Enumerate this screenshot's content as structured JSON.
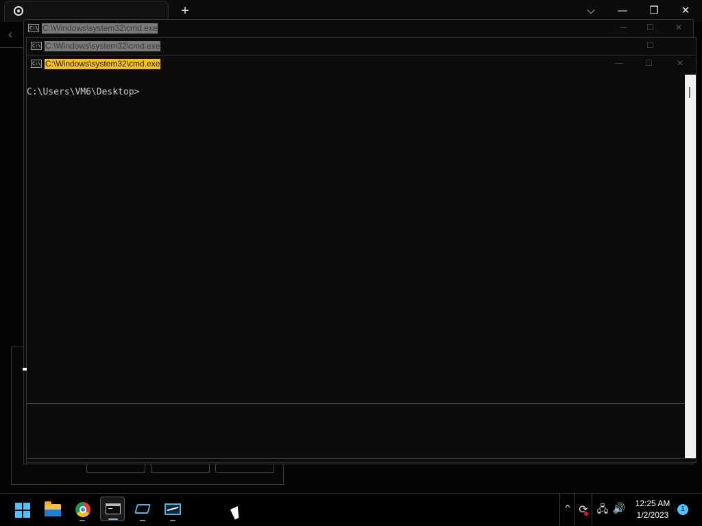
{
  "chrome": {
    "new_tab_symbol": "+",
    "controls": {
      "dropdown": "⌵",
      "minimize": "—",
      "restore": "❐",
      "close": "✕"
    }
  },
  "cmd_windows": [
    {
      "title": "C:\\Windows\\system32\\cmd.exe",
      "state": "background"
    },
    {
      "title": "C:\\Windows\\system32\\cmd.exe",
      "state": "background"
    },
    {
      "title": "C:\\Windows\\system32\\cmd.exe",
      "state": "active"
    }
  ],
  "cmd_controls": {
    "minimize": "—",
    "maximize": "☐",
    "close": "✕"
  },
  "cmd_icon_text": "C:\\",
  "console": {
    "prompt": "C:\\Users\\VM6\\Desktop>"
  },
  "taskbar": {
    "apps": [
      {
        "name": "start",
        "icon": "windows-logo-icon"
      },
      {
        "name": "file-explorer",
        "icon": "folder-icon"
      },
      {
        "name": "chrome",
        "icon": "chrome-icon"
      },
      {
        "name": "command-prompt",
        "icon": "cmd-icon",
        "active": true
      },
      {
        "name": "app-4",
        "icon": "parallelogram-icon"
      },
      {
        "name": "app-5",
        "icon": "monitor-chart-icon"
      }
    ],
    "tray": {
      "chevron": "^",
      "sync": "⟳",
      "network": "🖧",
      "volume": "🔊",
      "time": "12:25 AM",
      "date": "1/2/2023",
      "notifications": "1"
    }
  },
  "colors": {
    "active_title_bg": "#f5c117",
    "accent": "#4cc2ff"
  }
}
